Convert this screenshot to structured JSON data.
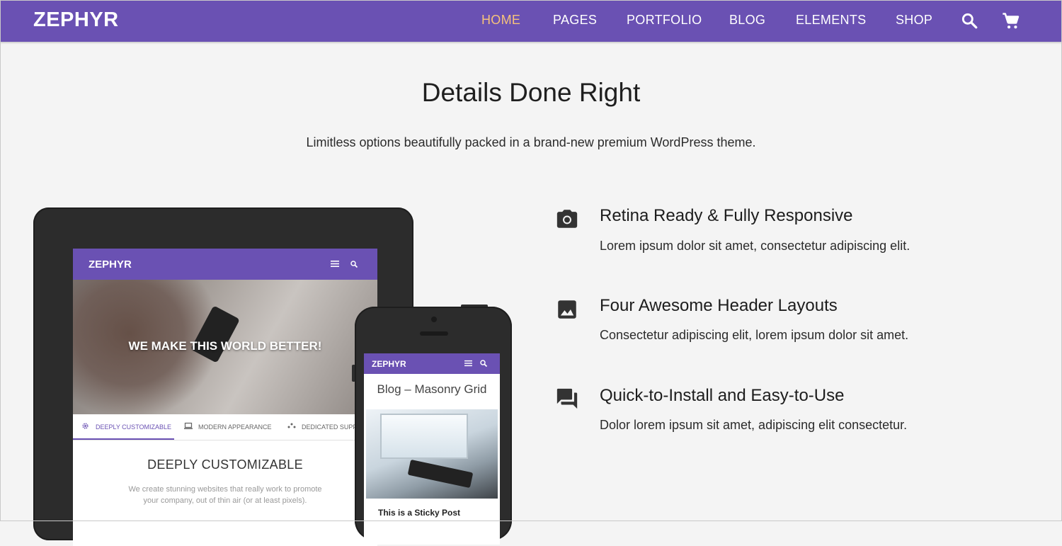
{
  "nav": {
    "logo": "ZEPHYR",
    "items": [
      {
        "label": "HOME",
        "active": true
      },
      {
        "label": "PAGES",
        "active": false
      },
      {
        "label": "PORTFOLIO",
        "active": false
      },
      {
        "label": "BLOG",
        "active": false
      },
      {
        "label": "ELEMENTS",
        "active": false
      },
      {
        "label": "SHOP",
        "active": false
      }
    ],
    "icons": [
      "search-icon",
      "cart-icon"
    ]
  },
  "hero": {
    "title": "Details Done Right",
    "subtitle": "Limitless options beautifully packed in a brand-new premium WordPress theme."
  },
  "tablet": {
    "logo": "ZEPHYR",
    "hero_text": "WE MAKE THIS WORLD BETTER!",
    "tabs": [
      "DEEPLY CUSTOMIZABLE",
      "MODERN APPEARANCE",
      "DEDICATED SUPPO"
    ],
    "content_title": "DEEPLY CUSTOMIZABLE",
    "content_text": "We create stunning websites that really work to promote your company, out of thin air (or at least pixels)."
  },
  "phone": {
    "logo": "ZEPHYR",
    "page_title": "Blog – Masonry Grid",
    "post_title": "This is a Sticky Post"
  },
  "features": [
    {
      "icon": "camera-icon",
      "title": "Retina Ready & Fully Responsive",
      "text": "Lorem ipsum dolor sit amet, consectetur adipiscing elit."
    },
    {
      "icon": "image-icon",
      "title": "Four Awesome Header Layouts",
      "text": "Consectetur adipiscing elit, lorem ipsum dolor sit amet."
    },
    {
      "icon": "chat-icon",
      "title": "Quick-to-Install and Easy-to-Use",
      "text": "Dolor lorem ipsum sit amet, adipiscing elit consectetur."
    }
  ],
  "colors": {
    "brand": "#6a51b3",
    "nav_active": "#f6c27b",
    "background": "#f4f4f4",
    "device": "#2c2c2c"
  }
}
